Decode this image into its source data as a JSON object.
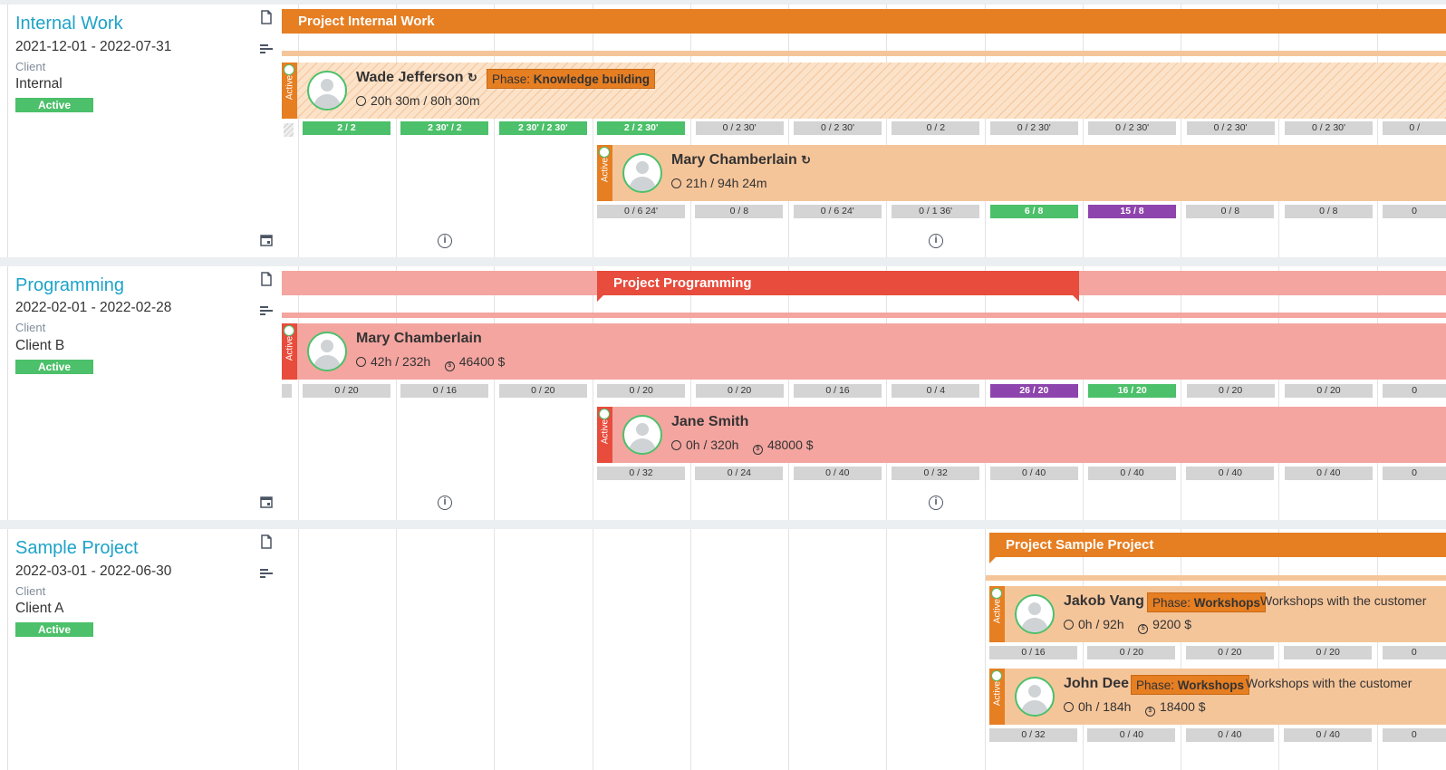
{
  "colors": {
    "orange": "#e67e22",
    "orange_light": "#f5c59a",
    "red": "#e74c3c",
    "red_light": "#f4a5a0",
    "green": "#4cc06a",
    "purple": "#8e44ad",
    "teal": "#1ea3c8"
  },
  "projects": [
    {
      "name": "Internal Work",
      "dates": "2021-12-01 - 2022-07-31",
      "client_label": "Client",
      "client": "Internal",
      "status": "Active",
      "bar_label": "Project Internal Work",
      "assignments": [
        {
          "status": "Active",
          "name": "Wade Jefferson",
          "stats": "20h 30m / 80h 30m",
          "phase_prefix": "Phase:",
          "phase": "Knowledge building",
          "cells": [
            "2 / 2",
            "2 30' / 2",
            "2 30' / 2 30'",
            "2 / 2 30'",
            "0 / 2 30'",
            "0 / 2 30'",
            "0 / 2",
            "0 / 2 30'",
            "0 / 2 30'",
            "0 / 2 30'",
            "0 / 2 30'",
            "0 /"
          ]
        },
        {
          "status": "Active",
          "name": "Mary Chamberlain",
          "stats": "21h / 94h 24m",
          "cells": [
            "0 / 6 24'",
            "0 / 8",
            "0 / 6 24'",
            "0 / 1 36'",
            "6 / 8",
            "15 / 8",
            "0 / 8",
            "0 / 8",
            "0"
          ]
        }
      ]
    },
    {
      "name": "Programming",
      "dates": "2022-02-01 - 2022-02-28",
      "client_label": "Client",
      "client": "Client B",
      "status": "Active",
      "bar_label": "Project Programming",
      "assignments": [
        {
          "status": "Active",
          "name": "Mary Chamberlain",
          "stats": "42h / 232h",
          "budget": "46400 $",
          "cells": [
            "0 / 20",
            "0 / 16",
            "0 / 20",
            "0 / 20",
            "0 / 20",
            "0 / 16",
            "0 / 4",
            "26 / 20",
            "16 / 20",
            "0 / 20",
            "0 / 20",
            "0"
          ]
        },
        {
          "status": "Active",
          "name": "Jane Smith",
          "stats": "0h / 320h",
          "budget": "48000 $",
          "cells": [
            "0 / 32",
            "0 / 24",
            "0 / 40",
            "0 / 32",
            "0 / 40",
            "0 / 40",
            "0 / 40",
            "0 / 40",
            "0"
          ]
        }
      ]
    },
    {
      "name": "Sample Project",
      "dates": "2022-03-01 - 2022-06-30",
      "client_label": "Client",
      "client": "Client A",
      "status": "Active",
      "bar_label": "Project Sample Project",
      "assignments": [
        {
          "status": "Active",
          "name": "Jakob Vang",
          "stats": "0h / 92h",
          "budget": "9200 $",
          "phase_prefix": "Phase:",
          "phase": "Workshops",
          "description": "Workshops with the customer",
          "cells": [
            "0 / 16",
            "0 / 20",
            "0 / 20",
            "0 / 20",
            "0"
          ]
        },
        {
          "status": "Active",
          "name": "John Dee",
          "stats": "0h / 184h",
          "budget": "18400 $",
          "phase_prefix": "Phase:",
          "phase": "Workshops",
          "description": "Workshops with the customer",
          "cells": [
            "0 / 32",
            "0 / 40",
            "0 / 40",
            "0 / 40",
            "0"
          ]
        }
      ]
    }
  ]
}
